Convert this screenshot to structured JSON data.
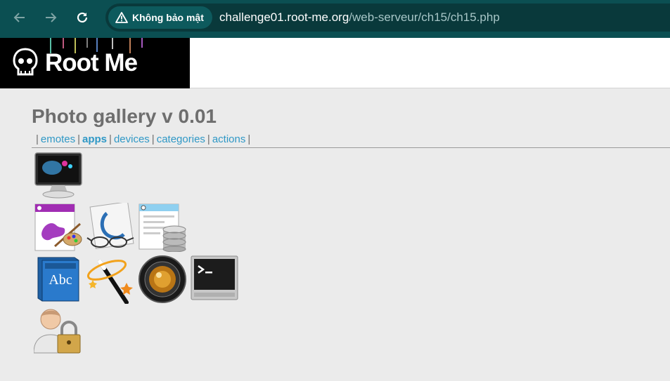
{
  "browser": {
    "security_label": "Không bảo mật",
    "url_host": "challenge01.root-me.org",
    "url_path": "/web-serveur/ch15/ch15.php",
    "theme_color": "#0b4f52"
  },
  "site": {
    "logo_text": "Root Me"
  },
  "page": {
    "title": "Photo gallery v 0.01",
    "menu": {
      "sep": "|",
      "items": [
        {
          "label": "emotes",
          "active": false
        },
        {
          "label": "apps",
          "active": true
        },
        {
          "label": "devices",
          "active": false
        },
        {
          "label": "categories",
          "active": false
        },
        {
          "label": "actions",
          "active": false
        }
      ]
    },
    "link_color": "#2f98c6",
    "gallery": [
      {
        "icon": "monitor-icon"
      },
      {
        "icon": "paint-app-icon"
      },
      {
        "icon": "preview-glasses-icon"
      },
      {
        "icon": "database-form-icon"
      },
      {
        "icon": "dictionary-book-icon"
      },
      {
        "icon": "magic-wand-icon"
      },
      {
        "icon": "camera-lens-icon"
      },
      {
        "icon": "terminal-icon"
      },
      {
        "icon": "user-lock-icon"
      }
    ]
  }
}
